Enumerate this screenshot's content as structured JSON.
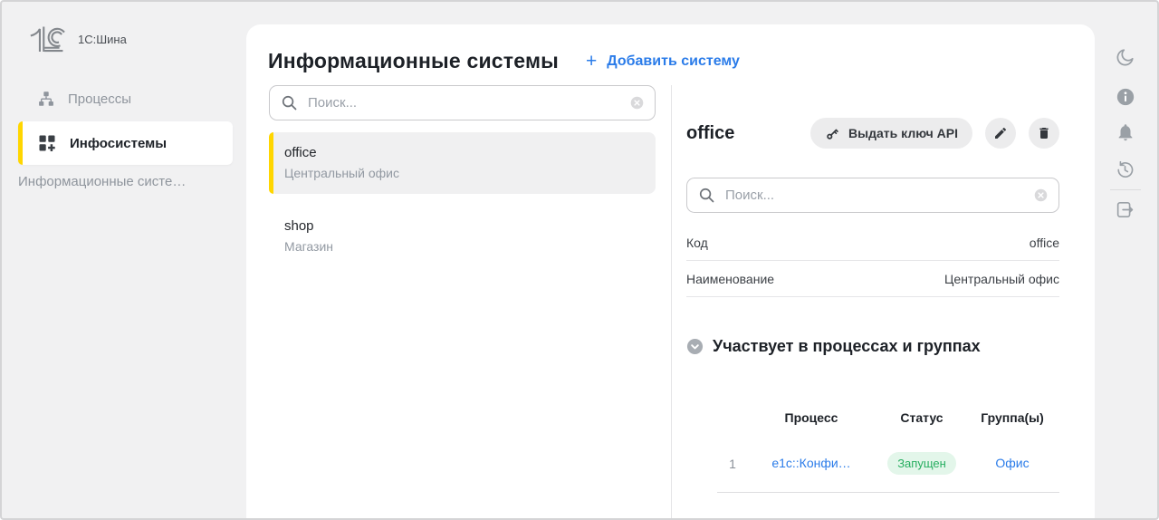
{
  "brand": {
    "name": "1С:Шина"
  },
  "sidebar": {
    "items": [
      {
        "label": "Процессы",
        "icon": "sitemap-icon",
        "active": false
      },
      {
        "label": "Инфосистемы",
        "icon": "grid-add-icon",
        "active": true
      }
    ],
    "sub_item": "Информационные систе…"
  },
  "header": {
    "title": "Информационные системы",
    "add_plus": "+",
    "add_button": "Добавить систему"
  },
  "list_panel": {
    "search_placeholder": "Поиск...",
    "items": [
      {
        "code": "office",
        "name": "Центральный офис",
        "selected": true
      },
      {
        "code": "shop",
        "name": "Магазин",
        "selected": false
      }
    ]
  },
  "detail_panel": {
    "title": "office",
    "api_key_button": "Выдать ключ API",
    "search_placeholder": "Поиск...",
    "fields": [
      {
        "label": "Код",
        "value": "office"
      },
      {
        "label": "Наименование",
        "value": "Центральный офис"
      }
    ],
    "section_title": "Участвует в процессах и группах",
    "table": {
      "headers": [
        "Процесс",
        "Статус",
        "Группа(ы)"
      ],
      "rows": [
        {
          "num": "1",
          "process": "e1c::Конфи…",
          "status": "Запущен",
          "groups": "Офис"
        }
      ]
    }
  },
  "toolbar": {
    "icons": [
      "moon-icon",
      "info-icon",
      "bell-icon",
      "history-icon",
      "logout-icon"
    ]
  },
  "colors": {
    "accent_yellow": "#ffd600",
    "link_blue": "#2b7ce9",
    "status_green": "#27ae60",
    "status_green_bg": "#e3f6ea"
  }
}
